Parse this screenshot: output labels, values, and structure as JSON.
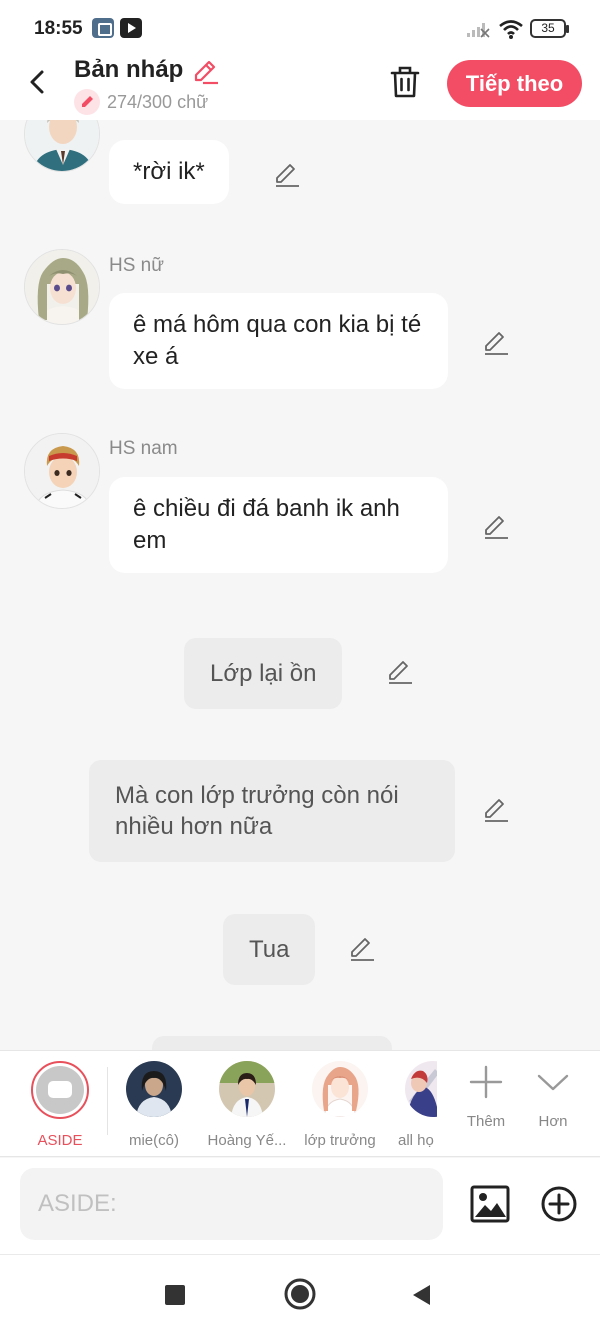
{
  "status_bar": {
    "time": "18:55",
    "battery": "35"
  },
  "header": {
    "title": "Bản nháp",
    "char_count": "274/300 chữ",
    "next_label": "Tiếp theo"
  },
  "messages": [
    {
      "type": "dialogue",
      "speaker": "",
      "text": "*rời ik*"
    },
    {
      "type": "dialogue",
      "speaker": "HS nữ",
      "text": "ê má hôm qua con kia bị té xe á"
    },
    {
      "type": "dialogue",
      "speaker": "HS nam",
      "text": "ê chiều đi đá banh ik anh em"
    },
    {
      "type": "narration",
      "text": "Lớp lại ồn"
    },
    {
      "type": "narration",
      "text": "Mà con lớp trưởng còn nói nhiều hơn nữa"
    },
    {
      "type": "narration",
      "text": "Tua"
    }
  ],
  "characters": [
    {
      "label": "ASIDE",
      "selected": true
    },
    {
      "label": "mie(cô)"
    },
    {
      "label": "Hoàng Yế..."
    },
    {
      "label": "lớp trưởng"
    },
    {
      "label": "all họ"
    }
  ],
  "tools": {
    "add_label": "Thêm",
    "more_label": "Hơn"
  },
  "input": {
    "placeholder": "ASIDE:",
    "value": ""
  },
  "colors": {
    "accent": "#f24d64",
    "aside_ring": "#e8505b",
    "background": "#f6f6f6"
  },
  "icons": [
    "back-arrow-icon",
    "pencil-icon",
    "trash-icon",
    "plus-icon",
    "chevron-down-icon",
    "image-icon",
    "add-circle-icon",
    "stop-icon",
    "home-icon",
    "back-triangle-icon"
  ]
}
